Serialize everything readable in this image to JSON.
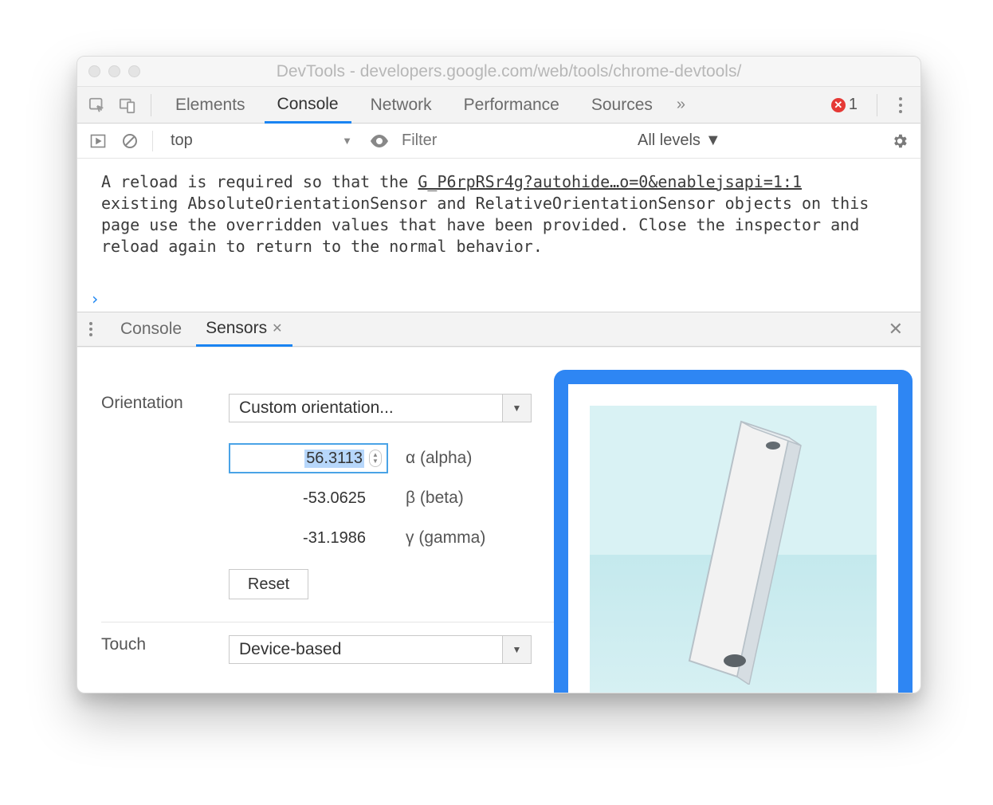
{
  "window": {
    "title": "DevTools - developers.google.com/web/tools/chrome-devtools/"
  },
  "tabs": {
    "items": [
      "Elements",
      "Console",
      "Network",
      "Performance",
      "Sources"
    ],
    "active": "Console",
    "overflow": "»",
    "error_count": "1"
  },
  "consoleToolbar": {
    "context": "top",
    "filter_placeholder": "Filter",
    "levels": "All levels"
  },
  "consoleMessage": {
    "pre_link": "A reload is required so that the ",
    "link": "G_P6rpRSr4g?autohide…o=0&enablejsapi=1:1",
    "rest": "existing AbsoluteOrientationSensor and RelativeOrientationSensor objects on this page use the overridden values that have been provided. Close the inspector and reload again to return to the normal behavior."
  },
  "drawer": {
    "tabs": [
      "Console",
      "Sensors"
    ],
    "active": "Sensors"
  },
  "sensors": {
    "orientation_label": "Orientation",
    "orientation_select": "Custom orientation...",
    "alpha": {
      "value": "56.3113",
      "label": "α (alpha)"
    },
    "beta": {
      "value": "-53.0625",
      "label": "β (beta)"
    },
    "gamma": {
      "value": "-31.1986",
      "label": "γ (gamma)"
    },
    "reset": "Reset",
    "touch_label": "Touch",
    "touch_select": "Device-based"
  }
}
